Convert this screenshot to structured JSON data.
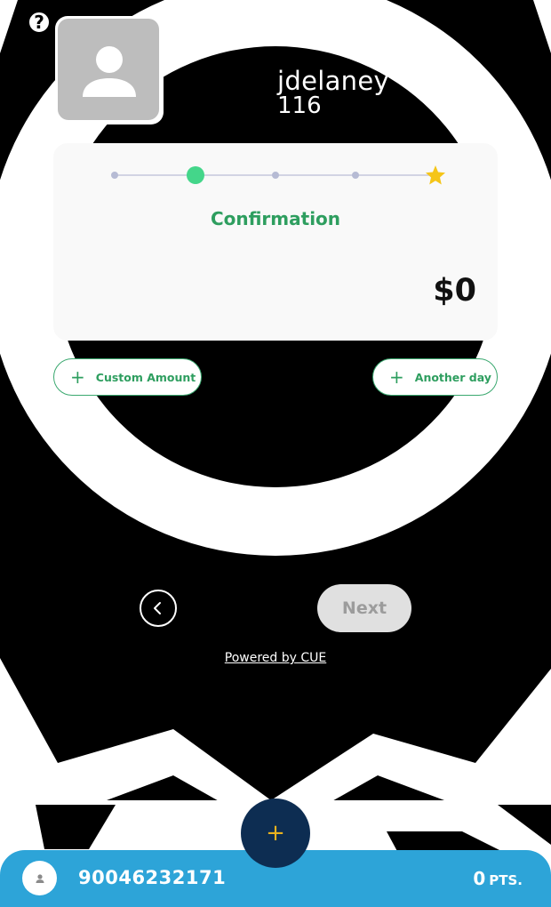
{
  "header": {
    "help_icon": "question-circle-icon",
    "help_glyph": "?",
    "avatar_icon": "user-placeholder-icon"
  },
  "user": {
    "name": "jdelaney",
    "id": "116"
  },
  "stepper": {
    "total_steps": 5,
    "active_step": 2,
    "final_icon": "star-icon",
    "colors": {
      "dot": "#b6bbd4",
      "active": "#44d68a",
      "star": "#f5c518",
      "line": "#c5c8dc"
    }
  },
  "card": {
    "step_title": "Confirmation",
    "amount": "$0"
  },
  "actions": {
    "custom_amount_label": "Custom Amount",
    "another_day_label": "Another day",
    "plus_glyph": "+"
  },
  "nav": {
    "back_icon": "chevron-left-icon",
    "next_label": "Next"
  },
  "footer": {
    "powered_by": "Powered by CUE"
  },
  "bottom_bar": {
    "phone": "90046232171",
    "points_value": "0",
    "points_unit": "PTS.",
    "fab_glyph": "+",
    "colors": {
      "bar": "#2da4d8",
      "fab": "#0d2d52",
      "fab_plus": "#e8b21f"
    }
  }
}
